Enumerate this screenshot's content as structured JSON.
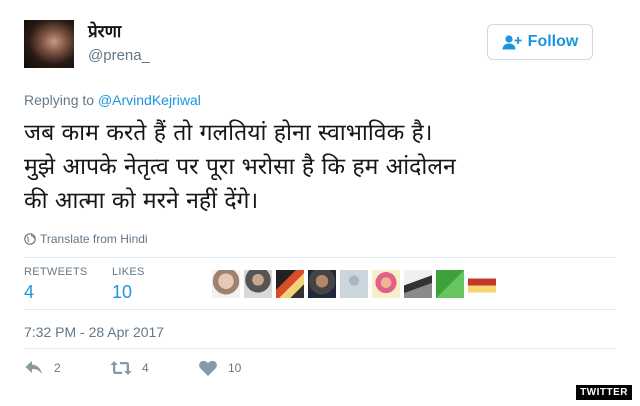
{
  "user": {
    "display_name": "प्रेरणा",
    "handle": "@prena_"
  },
  "follow_button": {
    "label": "Follow",
    "icon": "add-user-icon"
  },
  "reply": {
    "prefix": "Replying to ",
    "mention": "@ArvindKejriwal"
  },
  "tweet": {
    "lines": [
      "जब काम करते हैं तो गलतियां होना स्वाभाविक है।",
      "मुझे आपके नेतृत्व पर पूरा भरोसा है कि हम आंदोलन",
      "की आत्मा को मरने नहीं देंगे।"
    ]
  },
  "translate": {
    "label": "Translate from Hindi",
    "icon": "globe-icon"
  },
  "stats": {
    "retweets_label": "RETWEETS",
    "retweets_value": "4",
    "likes_label": "LIKES",
    "likes_value": "10"
  },
  "timestamp": "7:32 PM - 28 Apr 2017",
  "actions": {
    "reply_count": "2",
    "retweet_count": "4",
    "like_count": "10"
  },
  "watermark": "TWITTER",
  "colors": {
    "accent": "#1b95e0",
    "secondary_text": "#657786",
    "divider": "#e1e8ed"
  }
}
